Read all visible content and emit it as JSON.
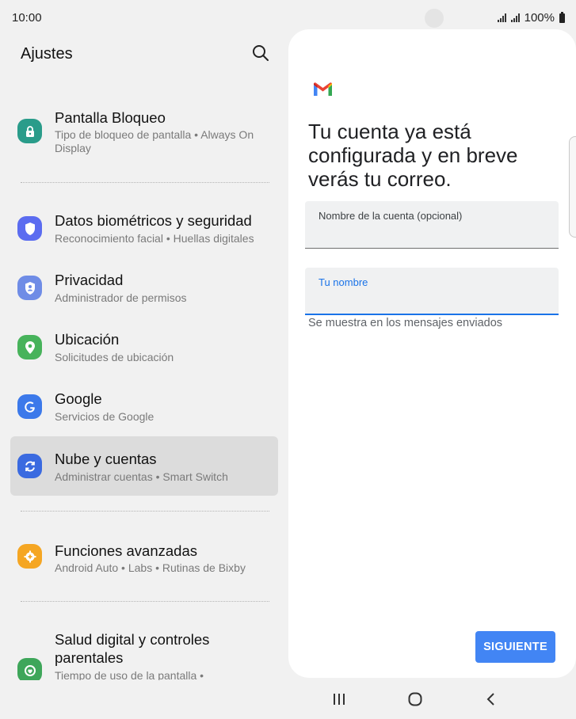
{
  "status_bar": {
    "time": "10:00",
    "battery": "100%"
  },
  "settings": {
    "title": "Ajustes",
    "items": [
      {
        "title": "Pantalla Bloqueo",
        "subtitle": "Tipo de bloqueo de pantalla  •  Always On Display",
        "icon": "lock-icon",
        "color": "#2a9c8a"
      },
      {
        "title": "Datos biométricos y seguridad",
        "subtitle": "Reconocimiento facial  •  Huellas digitales",
        "icon": "shield-icon",
        "color": "#5b6cf0"
      },
      {
        "title": "Privacidad",
        "subtitle": "Administrador de permisos",
        "icon": "privacy-shield-icon",
        "color": "#6f8ce6"
      },
      {
        "title": "Ubicación",
        "subtitle": "Solicitudes de ubicación",
        "icon": "location-pin-icon",
        "color": "#47b35b"
      },
      {
        "title": "Google",
        "subtitle": "Servicios de Google",
        "icon": "google-icon",
        "color": "#3c79ea"
      },
      {
        "title": "Nube y cuentas",
        "subtitle": "Administrar cuentas  •  Smart Switch",
        "icon": "sync-icon",
        "color": "#3a6ae0"
      },
      {
        "title": "Funciones avanzadas",
        "subtitle": "Android Auto  •  Labs  •  Rutinas de Bixby",
        "icon": "gear-plus-icon",
        "color": "#f5a623"
      },
      {
        "title": "Salud digital y controles parentales",
        "subtitle": "Tiempo de uso de la pantalla  •",
        "icon": "digital-wellbeing-icon",
        "color": "#3ea65a"
      }
    ]
  },
  "gmail_setup": {
    "heading": "Tu cuenta ya está configurada y en breve verás tu correo.",
    "account_name_label": "Nombre de la cuenta (opcional)",
    "account_name_value": "",
    "your_name_label": "Tu nombre",
    "your_name_value": "",
    "helper_text": "Se muestra en los mensajes enviados",
    "next_button": "SIGUIENTE",
    "accent_color": "#4285f4"
  }
}
